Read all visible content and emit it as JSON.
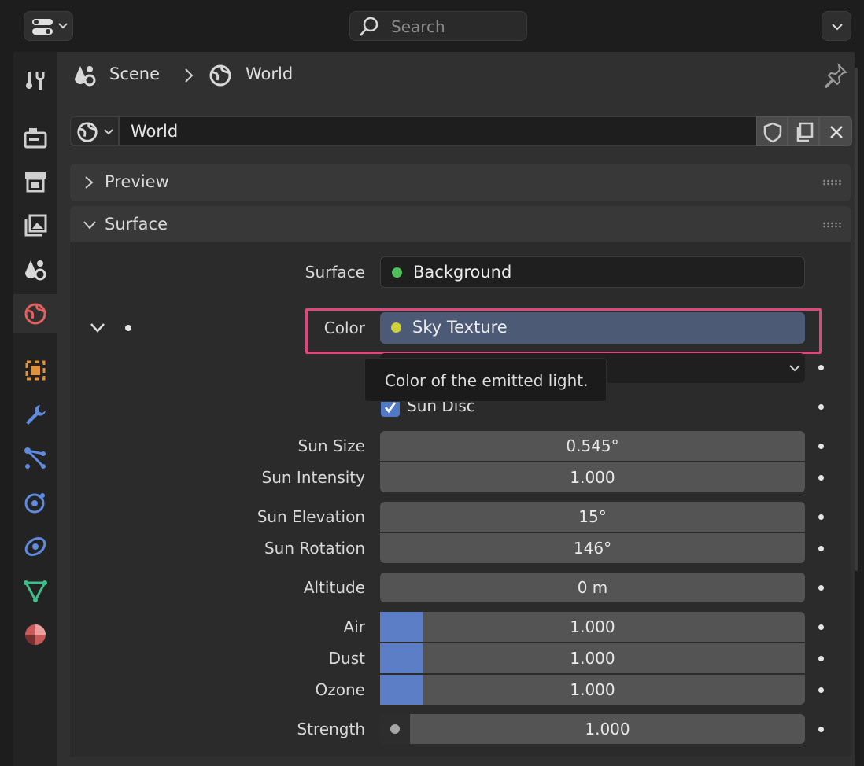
{
  "search": {
    "placeholder": "Search"
  },
  "breadcrumb": {
    "scene": "Scene",
    "world": "World"
  },
  "world_datablock": {
    "name": "World"
  },
  "sections": {
    "preview": "Preview",
    "surface": "Surface"
  },
  "surface": {
    "surface_label": "Surface",
    "surface_value": "Background",
    "surface_socket_color": "#4fbf5a",
    "color_label": "Color",
    "color_value": "Sky Texture",
    "color_socket_color": "#cfcf3a",
    "tooltip": "Color of the emitted light.",
    "sun_disc_label": "Sun Disc",
    "sun_disc_checked": true
  },
  "params": {
    "sun_size": {
      "label": "Sun Size",
      "value": "0.545°"
    },
    "sun_intensity": {
      "label": "Sun Intensity",
      "value": "1.000"
    },
    "sun_elevation": {
      "label": "Sun Elevation",
      "value": "15°"
    },
    "sun_rotation": {
      "label": "Sun Rotation",
      "value": "146°"
    },
    "altitude": {
      "label": "Altitude",
      "value": "0 m"
    },
    "air": {
      "label": "Air",
      "value": "1.000",
      "fill_fraction": 0.1
    },
    "dust": {
      "label": "Dust",
      "value": "1.000",
      "fill_fraction": 0.1
    },
    "ozone": {
      "label": "Ozone",
      "value": "1.000",
      "fill_fraction": 0.1
    },
    "strength": {
      "label": "Strength",
      "value": "1.000"
    }
  },
  "colors": {
    "highlight": "#e0467d",
    "accent": "#5b7ec6",
    "panel": "#303030"
  }
}
